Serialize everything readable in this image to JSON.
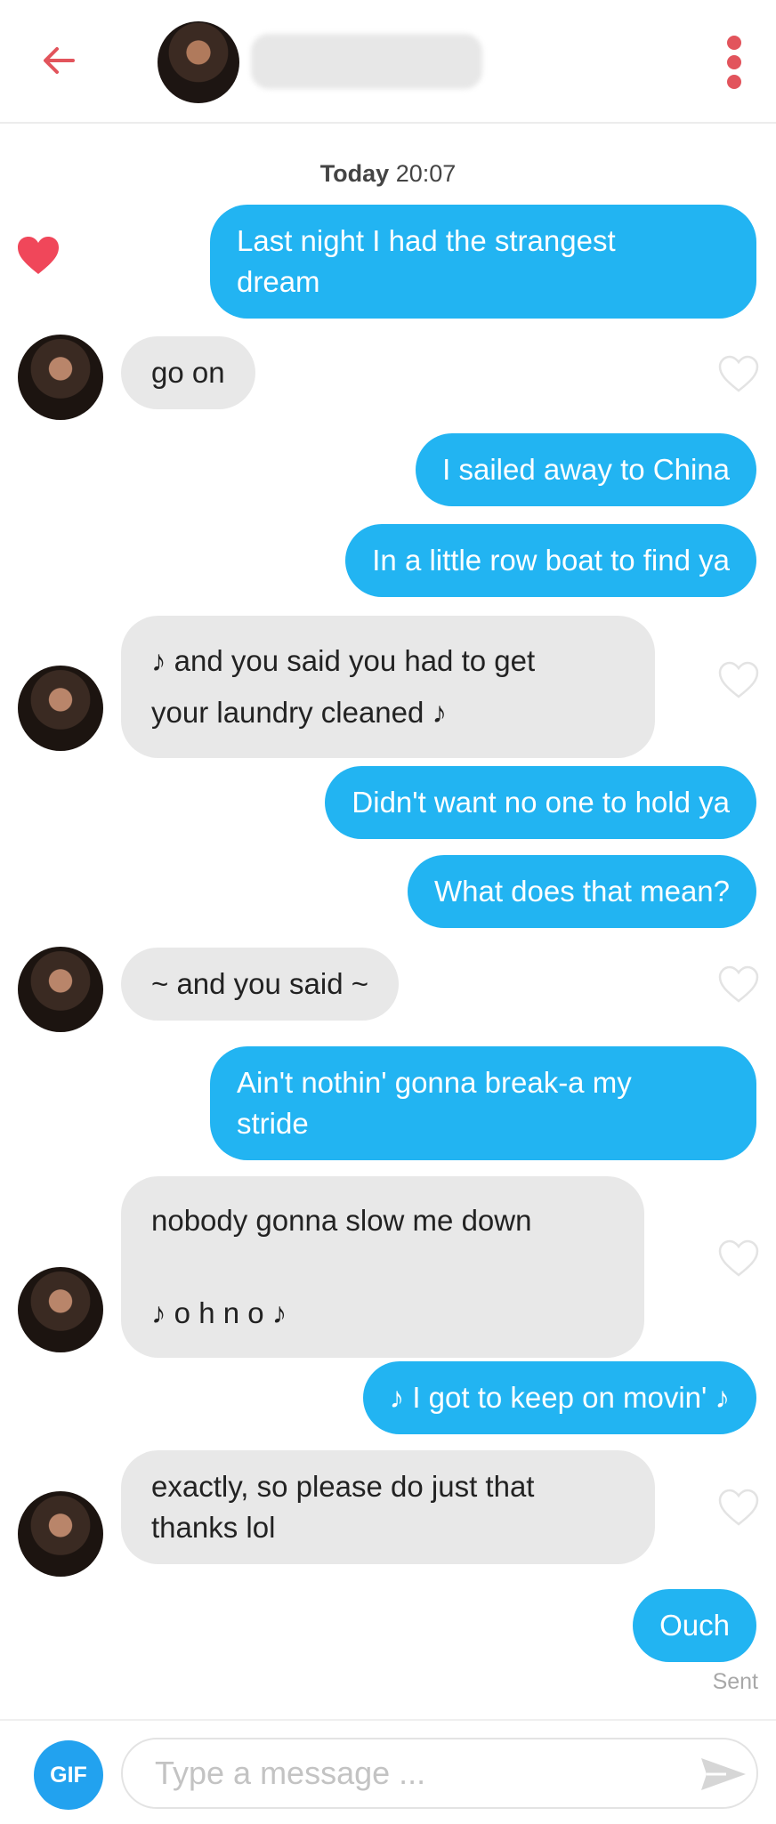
{
  "header": {
    "back_icon": "arrow-left-icon",
    "more_icon": "more-vertical-icon",
    "accent_color": "#e2545c"
  },
  "timestamp": {
    "day": "Today",
    "time": "20:07"
  },
  "messages": [
    {
      "side": "sent",
      "text": "Last night I had the strangest\ndream"
    },
    {
      "side": "received",
      "text": "go on"
    },
    {
      "side": "sent",
      "text": "I sailed away to China"
    },
    {
      "side": "sent",
      "text": "In a little row boat to find ya"
    },
    {
      "side": "received",
      "text": "♪ and you said you had to get\nyour laundry cleaned ♪"
    },
    {
      "side": "sent",
      "text": "Didn't want no one to hold ya"
    },
    {
      "side": "sent",
      "text": "What does that mean?"
    },
    {
      "side": "received",
      "text": "~ and you said ~"
    },
    {
      "side": "sent",
      "text": "Ain't nothin' gonna break-a my\nstride"
    },
    {
      "side": "received",
      "text": "nobody gonna slow me down\n\n♪ o h n o ♪"
    },
    {
      "side": "sent",
      "text": "♪ I got to keep on movin' ♪"
    },
    {
      "side": "received",
      "text": "exactly, so please do just that\nthanks lol"
    },
    {
      "side": "sent",
      "text": "Ouch"
    }
  ],
  "status": "Sent",
  "composer": {
    "gif_label": "GIF",
    "placeholder": "Type a message ...",
    "send_icon": "send-icon"
  },
  "colors": {
    "sent_bubble": "#22b4f2",
    "received_bubble": "#e8e8e8",
    "like_heart": "#f0475a"
  }
}
